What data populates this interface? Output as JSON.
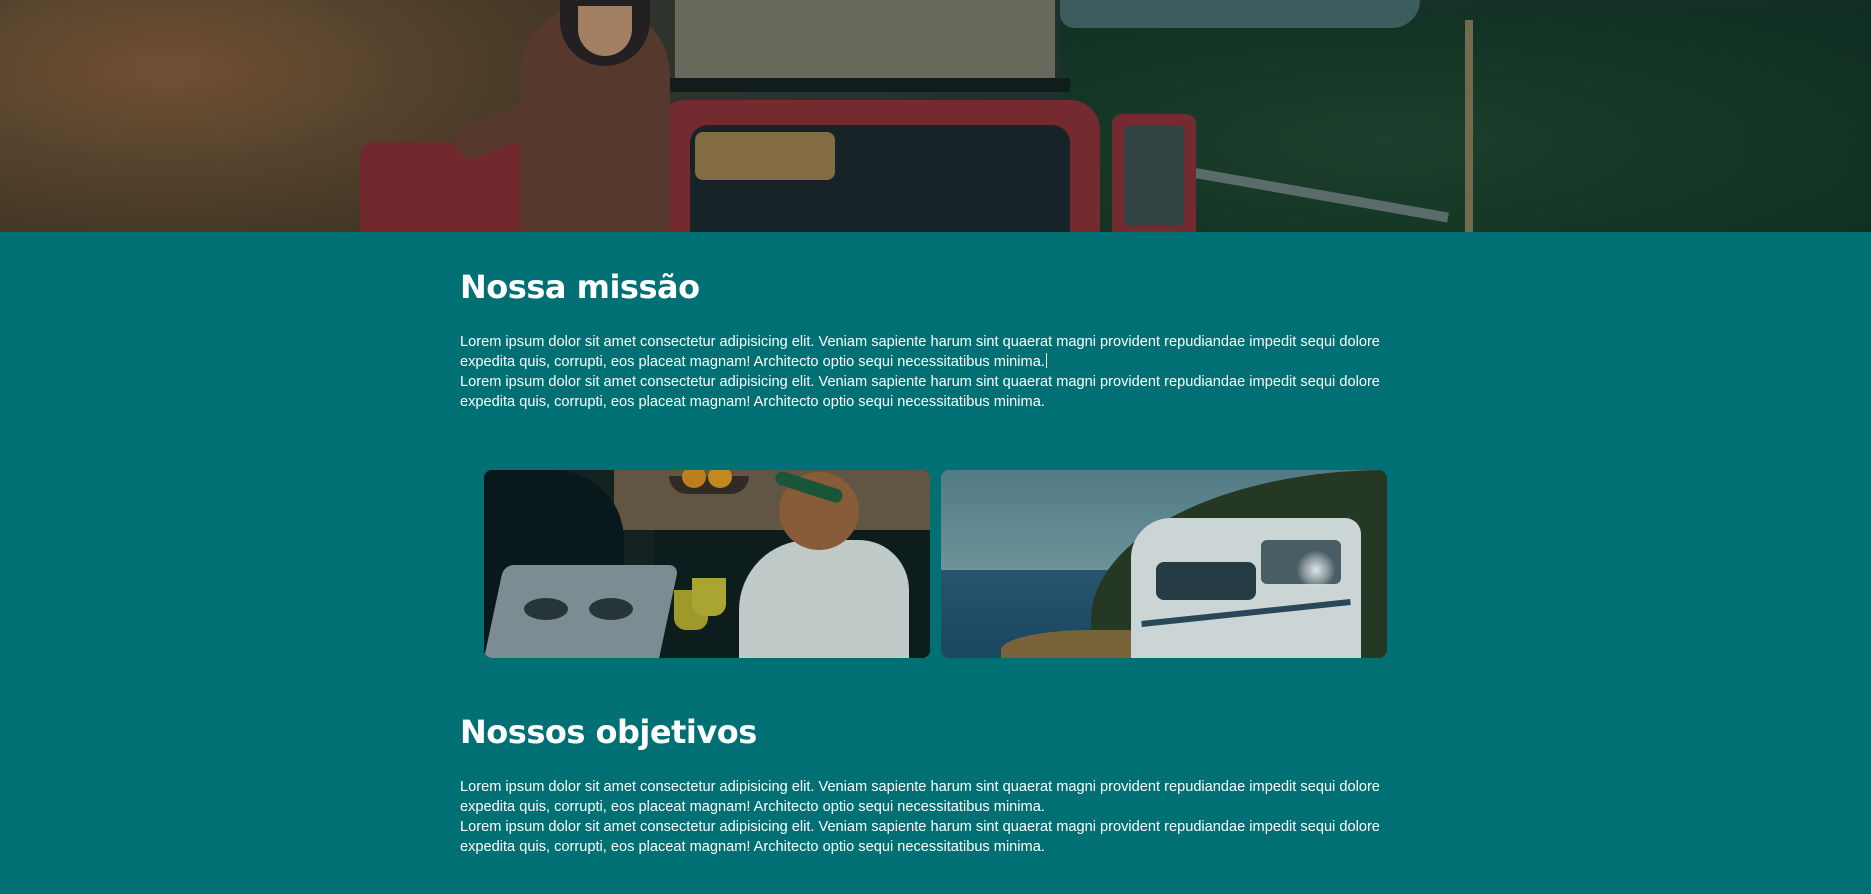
{
  "hero": {
    "alt": "hero-photo-woman-with-red-van"
  },
  "mission": {
    "title": "Nossa missão",
    "paragraphs": [
      "Lorem ipsum dolor sit amet consectetur adipisicing elit. Veniam sapiente harum sint quaerat magni provident repudiandae impedit sequi dolore expedita quis, corrupti, eos placeat magnam! Architecto optio sequi necessitatibus minima.",
      "Lorem ipsum dolor sit amet consectetur adipisicing elit. Veniam sapiente harum sint quaerat magni provident repudiandae impedit sequi dolore expedita quis, corrupti, eos placeat magnam! Architecto optio sequi necessitatibus minima."
    ]
  },
  "gallery": {
    "images": [
      {
        "name": "photo-woman-cooking-in-camper"
      },
      {
        "name": "photo-motorhome-by-the-sea"
      }
    ]
  },
  "objectives": {
    "title": "Nossos objetivos",
    "paragraphs": [
      "Lorem ipsum dolor sit amet consectetur adipisicing elit. Veniam sapiente harum sint quaerat magni provident repudiandae impedit sequi dolore expedita quis, corrupti, eos placeat magnam! Architecto optio sequi necessitatibus minima.",
      "Lorem ipsum dolor sit amet consectetur adipisicing elit. Veniam sapiente harum sint quaerat magni provident repudiandae impedit sequi dolore expedita quis, corrupti, eos placeat magnam! Architecto optio sequi necessitatibus minima."
    ]
  },
  "colors": {
    "background": "#007074",
    "text": "#ffffff"
  }
}
